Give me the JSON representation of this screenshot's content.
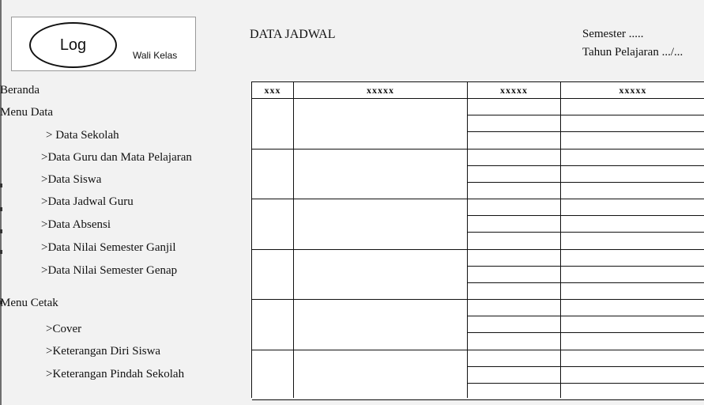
{
  "header": {
    "logo_text": "Log",
    "user_role": "Wali Kelas",
    "page_title": "DATA JADWAL",
    "semester": "Semester .....",
    "academic_year": "Tahun Pelajaran .../..."
  },
  "sidebar": {
    "items": [
      {
        "label": "Beranda"
      },
      {
        "label": "Menu Data"
      },
      {
        "label": "> Data Sekolah"
      },
      {
        "label": ">Data Guru dan Mata Pelajaran"
      },
      {
        "label": ">Data Siswa"
      },
      {
        "label": ">Data Jadwal Guru"
      },
      {
        "label": ">Data Absensi"
      },
      {
        "label": ">Data Nilai Semester Ganjil"
      },
      {
        "label": ">Data Nilai Semester Genap"
      },
      {
        "label": "Menu Cetak"
      },
      {
        "label": ">Cover"
      },
      {
        "label": ">Keterangan Diri Siswa"
      },
      {
        "label": ">Keterangan Pindah Sekolah"
      }
    ]
  },
  "table": {
    "columns": [
      "xxx",
      "xxxxx",
      "xxxxx",
      "xxxxx"
    ],
    "group_count": 6,
    "sub_rows_per_group": 3
  }
}
